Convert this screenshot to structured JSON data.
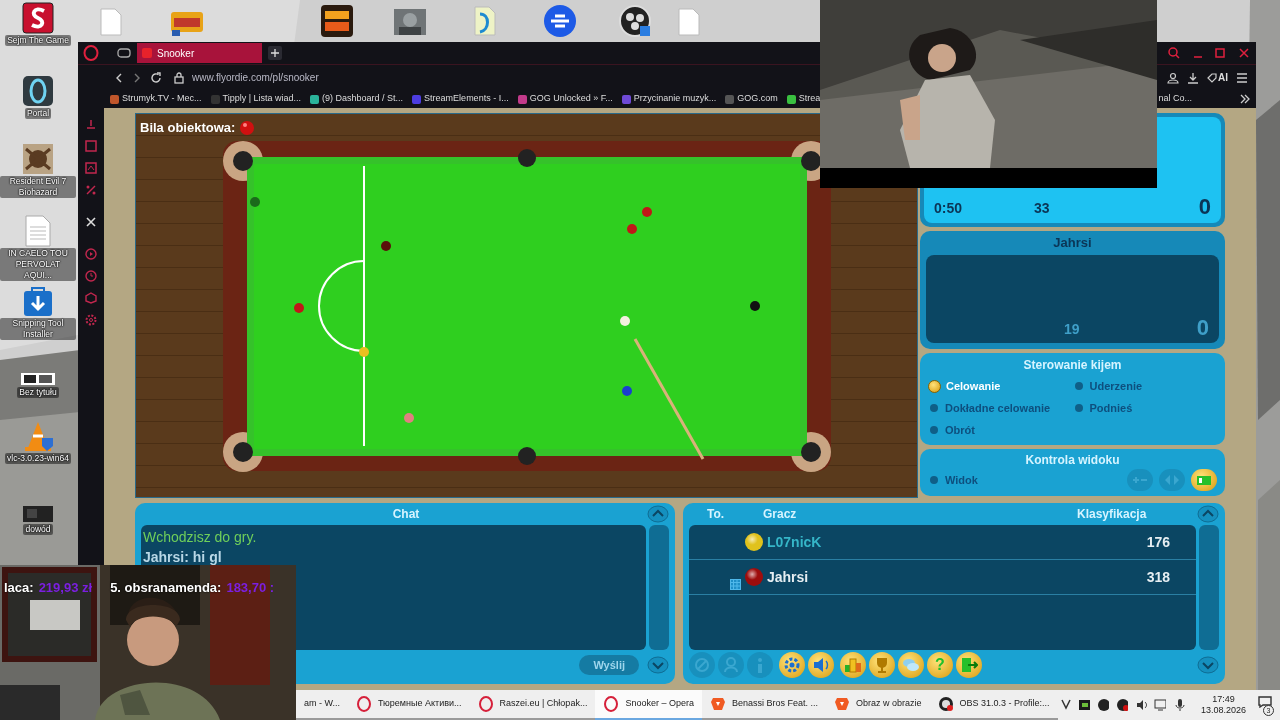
{
  "desktop_icons": [
    {
      "label": "Sejm The Game"
    },
    {
      "label": "Portal"
    },
    {
      "label": "Resident Evil 7 Biohazard"
    },
    {
      "label": "IN CAELO TOU PERVOLAT AQUI..."
    },
    {
      "label": "Snipping Tool Installer"
    },
    {
      "label": "Bez tytułu"
    },
    {
      "label": "vlc-3.0.23-win64"
    },
    {
      "label": "dowód"
    }
  ],
  "browser": {
    "tab": {
      "title": "Snooker",
      "selected": true
    },
    "url": "www.flyordie.com/pl/snooker",
    "ai_button": "AI",
    "bookmarks": [
      {
        "label": "Strumyk.TV - Mec..."
      },
      {
        "label": "Tipply | Lista wiad..."
      },
      {
        "label": "(9) Dashboard / St..."
      },
      {
        "label": "StreamElements - I..."
      },
      {
        "label": "GOG Unlocked » F..."
      },
      {
        "label": "Przycinanie muzyk..."
      },
      {
        "label": "GOG.com"
      },
      {
        "label": "Strea"
      }
    ],
    "bookmark_tail": "nal Co..."
  },
  "game": {
    "object_ball_label": "Bila obiektowa:",
    "player1": {
      "time": "0:50",
      "break": "33",
      "score": "0"
    },
    "player2": {
      "name": "Jahrsi",
      "break": "19",
      "score": "0"
    },
    "cue_control": {
      "title": "Sterowanie kijem",
      "options": [
        {
          "label": "Celowanie",
          "selected": true
        },
        {
          "label": "Uderzenie",
          "selected": false
        },
        {
          "label": "Dokładne celowanie",
          "selected": false
        },
        {
          "label": "Podnieś",
          "selected": false
        },
        {
          "label": "Obrót",
          "selected": false
        }
      ]
    },
    "view_control": {
      "title": "Kontrola widoku",
      "option": {
        "label": "Widok",
        "selected": false
      },
      "buttons": [
        {
          "kind": "zoom",
          "on": false
        },
        {
          "kind": "rotate",
          "on": false
        },
        {
          "kind": "camera",
          "on": true
        }
      ]
    },
    "chat": {
      "title": "Chat",
      "messages": [
        {
          "kind": "system",
          "text": "Wchodzisz do gry."
        },
        {
          "kind": "user",
          "text": "Jahrsi: hi gl"
        }
      ],
      "send_button": {
        "label": "Wyślij",
        "disabled": true
      }
    },
    "players": {
      "columns": [
        "To.",
        "Gracz",
        "Klasyfikacja"
      ],
      "rows": [
        {
          "color": "#e0c21c",
          "name": "L07nicK",
          "rating": "176",
          "active": true,
          "table_icon": false
        },
        {
          "color": "#9e0d0d",
          "name": "Jahrsi",
          "rating": "318",
          "active": false,
          "table_icon": true
        }
      ],
      "buttons": [
        {
          "kind": "block",
          "disabled": true
        },
        {
          "kind": "person",
          "disabled": true
        },
        {
          "kind": "info",
          "disabled": true
        },
        {
          "kind": "settings",
          "disabled": false
        },
        {
          "kind": "sound",
          "disabled": false
        },
        {
          "kind": "ranking",
          "disabled": false
        },
        {
          "kind": "trophy",
          "disabled": false
        },
        {
          "kind": "chat",
          "disabled": false
        },
        {
          "kind": "help",
          "disabled": false,
          "label": "?"
        },
        {
          "kind": "exit",
          "disabled": false
        }
      ]
    }
  },
  "stream_overlay": {
    "donors": [
      {
        "name": "laca:",
        "amount": "219,93 zł"
      },
      {
        "name": "5. obsranamenda:",
        "amount": "183,70 :"
      }
    ]
  },
  "taskbar": {
    "items": [
      {
        "kind": "none",
        "label": "am - W...",
        "selected": false
      },
      {
        "kind": "opera",
        "label": "Тюремные Активи...",
        "selected": false
      },
      {
        "kind": "opera",
        "label": "Raszei.eu | Chłopak...",
        "selected": false
      },
      {
        "kind": "opera",
        "label": "Snooker – Opera",
        "selected": true
      },
      {
        "kind": "brave",
        "label": "Benassi Bros Feat. ...",
        "selected": false
      },
      {
        "kind": "brave",
        "label": "Obraz w obrazie",
        "selected": false
      },
      {
        "kind": "obs",
        "label": "OBS 31.0.3 - Profile:...",
        "selected": false
      }
    ],
    "time": "17:49",
    "date": "13.08.2026",
    "notifications": "3"
  }
}
